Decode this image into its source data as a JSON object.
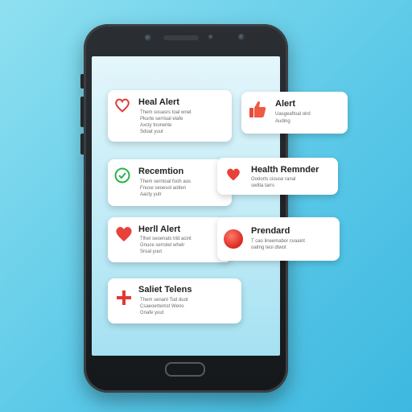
{
  "cards": [
    {
      "title": "Heal Alert",
      "lines": [
        "Them souasrs toal wnet",
        "Pkurte serrioal elafe",
        "Axcty tnorwrite",
        "Sdoat yuut"
      ]
    },
    {
      "title": "Alert",
      "lines": [
        "Uasgeaftoal olrd",
        "Auding"
      ]
    },
    {
      "title": "Recemtion",
      "lines": [
        "Them serntoal fooh aos",
        "Fnuse seoesol aotlen",
        "Aacty yutr"
      ]
    },
    {
      "title": "Health Remnder",
      "lines": [
        "Oodorts ciouse ranal",
        "swtita tarrs"
      ]
    },
    {
      "title": "Herll Alert",
      "lines": [
        "Tlhet seoenats trld acint",
        "Gnuce serrolet whelr",
        "Sroal yuut"
      ]
    },
    {
      "title": "Prendard",
      "lines": [
        "T cao lineemabor cvaaint",
        "oalmg teoi dtwot"
      ]
    },
    {
      "title": "Saliet Telens",
      "lines": [
        "Them senant Tod duot",
        "Csaeoertemst Weno",
        "Gnafe yuut"
      ]
    }
  ]
}
